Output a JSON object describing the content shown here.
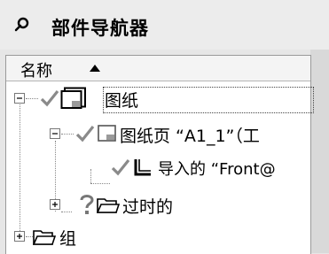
{
  "header": {
    "title": "部件导航器",
    "icon": "navigator-pin-icon"
  },
  "columns": {
    "name_label": "名称",
    "sort_icon": "sort-ascending-icon"
  },
  "tree": {
    "drawing": "图纸",
    "sheet": "图纸页 “A1_1”（工",
    "imported_view": "导入的 “Front@",
    "obsolete": "过时的",
    "group": "组"
  },
  "colors": {
    "check": "#8a8a8a",
    "selection_border": "#444444"
  }
}
